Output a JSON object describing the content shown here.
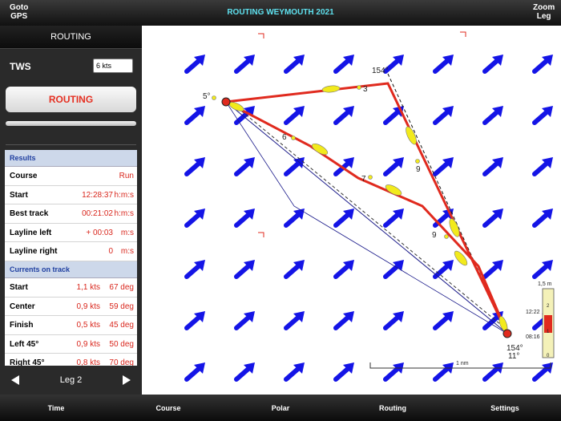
{
  "topbar": {
    "left_line1": "Goto",
    "left_line2": "GPS",
    "title": "ROUTING WEYMOUTH 2021",
    "right_line1": "Zoom",
    "right_line2": "Leg"
  },
  "sidebar": {
    "header": "ROUTING",
    "tws_label": "TWS",
    "tws_value": "6 kts",
    "routing_button": "ROUTING",
    "results_header": "Results",
    "results": [
      {
        "label": "Course",
        "value": "Run",
        "unit": ""
      },
      {
        "label": "Start",
        "value": "12:28:37",
        "unit": "h:m:s"
      },
      {
        "label": "Best track",
        "value": "00:21:02",
        "unit": "h:m:s"
      },
      {
        "label": "Layline left",
        "value": "+ 00:03",
        "unit": "m:s"
      },
      {
        "label": "Layline right",
        "value": "0",
        "unit": "m:s"
      }
    ],
    "currents_header": "Currents on track",
    "currents": [
      {
        "label": "Start",
        "speed": "1,1 kts",
        "dir": "67 deg"
      },
      {
        "label": "Center",
        "speed": "0,9 kts",
        "dir": "59 deg"
      },
      {
        "label": "Finish",
        "speed": "0,5 kts",
        "dir": "45 deg"
      },
      {
        "label": "Left 45°",
        "speed": "0,9 kts",
        "dir": "50 deg"
      },
      {
        "label": "Right 45°",
        "speed": "0,8 kts",
        "dir": "70 deg"
      }
    ],
    "leg_label": "Leg 2"
  },
  "map": {
    "labels": {
      "start_angle": "5°",
      "top_angle": "154°",
      "end_angle1": "154°",
      "end_angle2": "11°",
      "mark3": "3",
      "mark6": "6",
      "mark7": "7",
      "mark9a": "9",
      "mark9b": "9"
    },
    "scale_label": "1 nm",
    "tide": {
      "height": "1,5 m",
      "time1": "12:22",
      "time2": "08:16",
      "tick2": "2",
      "tick1": "1",
      "tick0": "0"
    },
    "colors": {
      "current_arrow": "#1414e6",
      "route": "#e02a1e",
      "layline": "#1a1a8a",
      "boat": "#f2ea1c"
    }
  },
  "bottombar": {
    "tabs": [
      "Time",
      "Course",
      "Polar",
      "Routing",
      "Settings"
    ]
  }
}
